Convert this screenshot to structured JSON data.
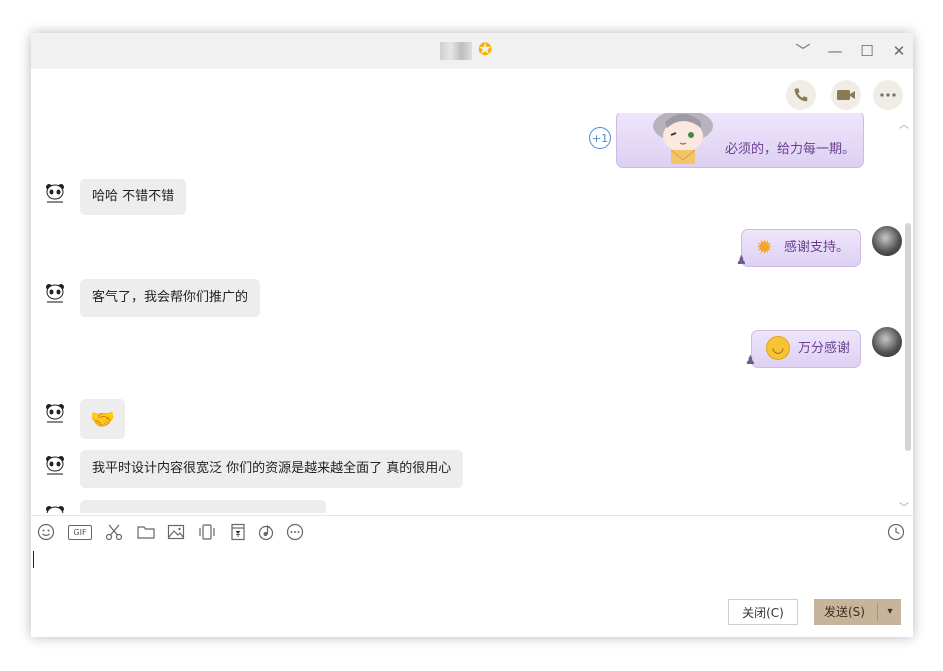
{
  "window": {
    "title_vip_icon": "star-badge-icon",
    "controls": {
      "dropdown": "﹀",
      "minimize": "—",
      "maximize": "☐",
      "close": "✕"
    }
  },
  "actions": [
    "phone-icon",
    "video-icon",
    "more-icon"
  ],
  "messages": [
    {
      "side": "right",
      "text": "必须的，给力每一期。",
      "reaction": "+1"
    },
    {
      "side": "left",
      "text": "哈哈 不错不错"
    },
    {
      "side": "right",
      "text": "感谢支持。"
    },
    {
      "side": "left",
      "text": "客气了，我会帮你们推广的"
    },
    {
      "side": "right",
      "text": "万分感谢"
    },
    {
      "side": "left",
      "emoji": "🤝"
    },
    {
      "side": "left",
      "text": "我平时设计内容很宽泛 你们的资源是越来越全面了 真的很用心"
    }
  ],
  "toolbar": [
    "emoji-icon",
    "gif-icon",
    "scissors-icon",
    "folder-icon",
    "image-icon",
    "shake-icon",
    "red-packet-icon",
    "music-icon",
    "more-icon",
    "history-icon"
  ],
  "gif_label": "GIF",
  "buttons": {
    "close": "关闭(C)",
    "send": "发送(S)",
    "send_arrow": "▾"
  },
  "colors": {
    "bubble_left": "#ededed",
    "bubble_right": "#e4d8f8",
    "accent": "#c7b49a"
  }
}
